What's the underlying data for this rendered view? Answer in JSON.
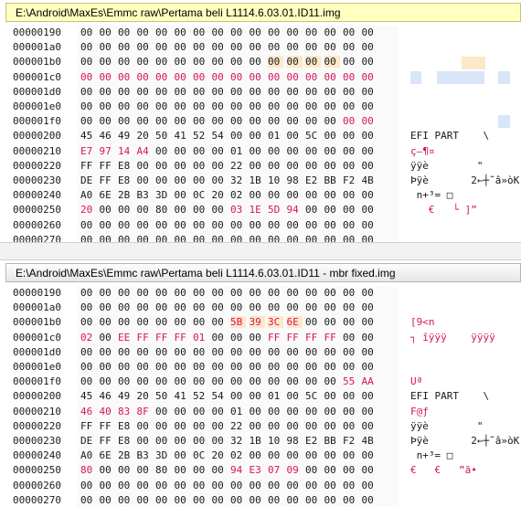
{
  "top": {
    "title": "E:\\Android\\MaxEs\\Emmc raw\\Pertama beli L1114.6.03.01.ID11.img",
    "rows": [
      {
        "off": "00000190",
        "hex": [
          "00",
          "00",
          "00",
          "00",
          "00",
          "00",
          "00",
          "00",
          "00",
          "00",
          "00",
          "00",
          "00",
          "00",
          "00",
          "00"
        ],
        "ascii": ""
      },
      {
        "off": "000001a0",
        "hex": [
          "00",
          "00",
          "00",
          "00",
          "00",
          "00",
          "00",
          "00",
          "00",
          "00",
          "00",
          "00",
          "00",
          "00",
          "00",
          "00"
        ],
        "ascii": ""
      },
      {
        "off": "000001b0",
        "hex": [
          "00",
          "00",
          "00",
          "00",
          "00",
          "00",
          "00",
          "00",
          "00",
          "00",
          "00",
          "00",
          "00",
          "00",
          "00",
          "00"
        ],
        "ascii": ""
      },
      {
        "off": "000001c0",
        "hex": [
          "00",
          "00",
          "00",
          "00",
          "00",
          "00",
          "00",
          "00",
          "00",
          "00",
          "00",
          "00",
          "00",
          "00",
          "00",
          "00"
        ],
        "ascii": ""
      },
      {
        "off": "000001d0",
        "hex": [
          "00",
          "00",
          "00",
          "00",
          "00",
          "00",
          "00",
          "00",
          "00",
          "00",
          "00",
          "00",
          "00",
          "00",
          "00",
          "00"
        ],
        "ascii": ""
      },
      {
        "off": "000001e0",
        "hex": [
          "00",
          "00",
          "00",
          "00",
          "00",
          "00",
          "00",
          "00",
          "00",
          "00",
          "00",
          "00",
          "00",
          "00",
          "00",
          "00"
        ],
        "ascii": ""
      },
      {
        "off": "000001f0",
        "hex": [
          "00",
          "00",
          "00",
          "00",
          "00",
          "00",
          "00",
          "00",
          "00",
          "00",
          "00",
          "00",
          "00",
          "00",
          "00",
          "00"
        ],
        "ascii": ""
      },
      {
        "off": "00000200",
        "hex": [
          "45",
          "46",
          "49",
          "20",
          "50",
          "41",
          "52",
          "54",
          "00",
          "00",
          "01",
          "00",
          "5C",
          "00",
          "00",
          "00"
        ],
        "ascii": "EFI PART    \\"
      },
      {
        "off": "00000210",
        "hex": [
          "E7",
          "97",
          "14",
          "A4",
          "00",
          "00",
          "00",
          "00",
          "01",
          "00",
          "00",
          "00",
          "00",
          "00",
          "00",
          "00"
        ],
        "ascii": "ç—¶¤"
      },
      {
        "off": "00000220",
        "hex": [
          "FF",
          "FF",
          "E8",
          "00",
          "00",
          "00",
          "00",
          "00",
          "22",
          "00",
          "00",
          "00",
          "00",
          "00",
          "00",
          "00"
        ],
        "ascii": "ÿÿè        \""
      },
      {
        "off": "00000230",
        "hex": [
          "DE",
          "FF",
          "E8",
          "00",
          "00",
          "00",
          "00",
          "00",
          "32",
          "1B",
          "10",
          "98",
          "E2",
          "BB",
          "F2",
          "4B"
        ],
        "ascii": "Þÿè       2←┼˜â»òK"
      },
      {
        "off": "00000240",
        "hex": [
          "A0",
          "6E",
          "2B",
          "B3",
          "3D",
          "00",
          "0C",
          "20",
          "02",
          "00",
          "00",
          "00",
          "00",
          "00",
          "00",
          "00"
        ],
        "ascii": " n+³= □"
      },
      {
        "off": "00000250",
        "hex": [
          "20",
          "00",
          "00",
          "00",
          "80",
          "00",
          "00",
          "00",
          "03",
          "1E",
          "5D",
          "94",
          "00",
          "00",
          "00",
          "00"
        ],
        "ascii": "   €   └ ]”"
      },
      {
        "off": "00000260",
        "hex": [
          "00",
          "00",
          "00",
          "00",
          "00",
          "00",
          "00",
          "00",
          "00",
          "00",
          "00",
          "00",
          "00",
          "00",
          "00",
          "00"
        ],
        "ascii": ""
      },
      {
        "off": "00000270",
        "hex": [
          "00",
          "00",
          "00",
          "00",
          "00",
          "00",
          "00",
          "00",
          "00",
          "00",
          "00",
          "00",
          "00",
          "00",
          "00",
          "00"
        ],
        "ascii": ""
      }
    ]
  },
  "bottom": {
    "title": "E:\\Android\\MaxEs\\Emmc raw\\Pertama beli L1114.6.03.01.ID11 - mbr fixed.img",
    "rows": [
      {
        "off": "00000190",
        "hex": [
          "00",
          "00",
          "00",
          "00",
          "00",
          "00",
          "00",
          "00",
          "00",
          "00",
          "00",
          "00",
          "00",
          "00",
          "00",
          "00"
        ],
        "ascii": ""
      },
      {
        "off": "000001a0",
        "hex": [
          "00",
          "00",
          "00",
          "00",
          "00",
          "00",
          "00",
          "00",
          "00",
          "00",
          "00",
          "00",
          "00",
          "00",
          "00",
          "00"
        ],
        "ascii": ""
      },
      {
        "off": "000001b0",
        "hex": [
          "00",
          "00",
          "00",
          "00",
          "00",
          "00",
          "00",
          "00",
          "5B",
          "39",
          "3C",
          "6E",
          "00",
          "00",
          "00",
          "00"
        ],
        "ascii": "[9<n"
      },
      {
        "off": "000001c0",
        "hex": [
          "02",
          "00",
          "EE",
          "FF",
          "FF",
          "FF",
          "01",
          "00",
          "00",
          "00",
          "FF",
          "FF",
          "FF",
          "FF",
          "00",
          "00"
        ],
        "ascii": "┐ îÿÿÿ    ÿÿÿÿ"
      },
      {
        "off": "000001d0",
        "hex": [
          "00",
          "00",
          "00",
          "00",
          "00",
          "00",
          "00",
          "00",
          "00",
          "00",
          "00",
          "00",
          "00",
          "00",
          "00",
          "00"
        ],
        "ascii": ""
      },
      {
        "off": "000001e0",
        "hex": [
          "00",
          "00",
          "00",
          "00",
          "00",
          "00",
          "00",
          "00",
          "00",
          "00",
          "00",
          "00",
          "00",
          "00",
          "00",
          "00"
        ],
        "ascii": ""
      },
      {
        "off": "000001f0",
        "hex": [
          "00",
          "00",
          "00",
          "00",
          "00",
          "00",
          "00",
          "00",
          "00",
          "00",
          "00",
          "00",
          "00",
          "00",
          "55",
          "AA"
        ],
        "ascii": "Uª"
      },
      {
        "off": "00000200",
        "hex": [
          "45",
          "46",
          "49",
          "20",
          "50",
          "41",
          "52",
          "54",
          "00",
          "00",
          "01",
          "00",
          "5C",
          "00",
          "00",
          "00"
        ],
        "ascii": "EFI PART    \\"
      },
      {
        "off": "00000210",
        "hex": [
          "46",
          "40",
          "83",
          "8F",
          "00",
          "00",
          "00",
          "00",
          "01",
          "00",
          "00",
          "00",
          "00",
          "00",
          "00",
          "00"
        ],
        "ascii": "F@ƒ"
      },
      {
        "off": "00000220",
        "hex": [
          "FF",
          "FF",
          "E8",
          "00",
          "00",
          "00",
          "00",
          "00",
          "22",
          "00",
          "00",
          "00",
          "00",
          "00",
          "00",
          "00"
        ],
        "ascii": "ÿÿè        \""
      },
      {
        "off": "00000230",
        "hex": [
          "DE",
          "FF",
          "E8",
          "00",
          "00",
          "00",
          "00",
          "00",
          "32",
          "1B",
          "10",
          "98",
          "E2",
          "BB",
          "F2",
          "4B"
        ],
        "ascii": "Þÿè       2←┼˜â»òK"
      },
      {
        "off": "00000240",
        "hex": [
          "A0",
          "6E",
          "2B",
          "B3",
          "3D",
          "00",
          "0C",
          "20",
          "02",
          "00",
          "00",
          "00",
          "00",
          "00",
          "00",
          "00"
        ],
        "ascii": " n+³= □"
      },
      {
        "off": "00000250",
        "hex": [
          "80",
          "00",
          "00",
          "00",
          "80",
          "00",
          "00",
          "00",
          "94",
          "E3",
          "07",
          "09",
          "00",
          "00",
          "00",
          "00"
        ],
        "ascii": "€   €   ”ã•"
      },
      {
        "off": "00000260",
        "hex": [
          "00",
          "00",
          "00",
          "00",
          "00",
          "00",
          "00",
          "00",
          "00",
          "00",
          "00",
          "00",
          "00",
          "00",
          "00",
          "00"
        ],
        "ascii": ""
      },
      {
        "off": "00000270",
        "hex": [
          "00",
          "00",
          "00",
          "00",
          "00",
          "00",
          "00",
          "00",
          "00",
          "00",
          "00",
          "00",
          "00",
          "00",
          "00",
          "00"
        ],
        "ascii": ""
      }
    ]
  },
  "colors": {
    "changed": "#d6155a",
    "selection": "#fde8c8",
    "ascii_block": "#d8e6f7"
  }
}
